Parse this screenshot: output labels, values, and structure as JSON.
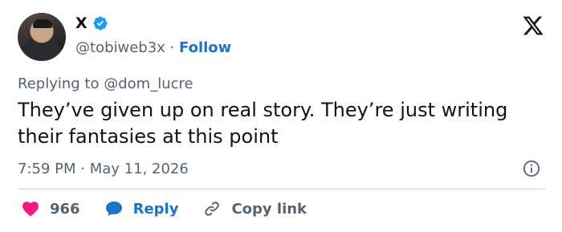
{
  "author": {
    "name": "X",
    "handle": "@tobiweb3x",
    "separator": "·",
    "follow_label": "Follow"
  },
  "tweet": {
    "reply_prefix": "Replying to",
    "reply_to": "@dom_lucre",
    "text": "They’ve given up on real story. They’re just writing their fantasies at this point",
    "time": "7:59 PM",
    "date_separator": "·",
    "date": "May 11, 2026"
  },
  "actions": {
    "like_count": "966",
    "reply_label": "Reply",
    "copy_label": "Copy link"
  },
  "colors": {
    "accent": "#1d72c9",
    "verified": "#1d9bf0",
    "heart": "#f91880",
    "muted": "#536471",
    "text": "#0f1419",
    "divider": "#cfd9de"
  },
  "icons": [
    "verified-badge-icon",
    "x-logo-icon",
    "info-icon",
    "heart-icon",
    "reply-bubble-icon",
    "link-icon"
  ]
}
